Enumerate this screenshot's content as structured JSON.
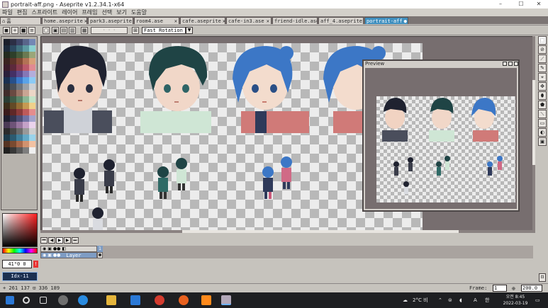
{
  "window": {
    "title": "portrait-aff.png - Aseprite v1.2.34.1-x64",
    "controls": {
      "minimize": "–",
      "maximize": "☐",
      "close": "✕"
    }
  },
  "menu": [
    "파일",
    "편집",
    "스프라이트",
    "레이어",
    "프레임",
    "선택",
    "보기",
    "도움말"
  ],
  "tabs": [
    {
      "label": "home.aseprite",
      "active": false
    },
    {
      "label": "park3.aseprite",
      "active": false
    },
    {
      "label": "room4.ase",
      "active": false
    },
    {
      "label": "cafe.aseprite",
      "active": false
    },
    {
      "label": "cafe-in3.ase",
      "active": false
    },
    {
      "label": "friend-idle.ase",
      "active": false
    },
    {
      "label": "aff_4.aseprite",
      "active": false
    },
    {
      "label": "portrait-aff",
      "active": true
    }
  ],
  "home_tab": "홈",
  "context_bar": {
    "rotation_algorithm": "Fast Rotation",
    "slider_placeholder": "· · ·"
  },
  "palette": {
    "colors": [
      "#1b1f2a",
      "#2c2f45",
      "#3e4466",
      "#59658a",
      "#7387b4",
      "#1d2a3a",
      "#2d4960",
      "#41707e",
      "#5d9aa2",
      "#8ad0cf",
      "#232a1e",
      "#2e3f2a",
      "#455a3b",
      "#6a7a52",
      "#9aa679",
      "#3a2320",
      "#5b3329",
      "#834a35",
      "#b37255",
      "#d9a079",
      "#3b1d2b",
      "#5d2a3c",
      "#8a3d50",
      "#bb5a6b",
      "#e08a92",
      "#2a1f3a",
      "#443065",
      "#5d4a8c",
      "#8577b6",
      "#b3addb",
      "#1a3050",
      "#27508a",
      "#3b7acb",
      "#5aa3e8",
      "#8ccbf5",
      "#2e3339",
      "#4a5058",
      "#6f767e",
      "#9aa1a8",
      "#ccd1d6",
      "#402c2a",
      "#6a4a42",
      "#9a7466",
      "#c9a593",
      "#ecd6c6",
      "#2a3d33",
      "#3f5c48",
      "#5b8367",
      "#8bb694",
      "#c2e3c7",
      "#3b2d1a",
      "#634a26",
      "#936d35",
      "#c69a52",
      "#f0d08a",
      "#3a1b1b",
      "#5f2828",
      "#8c3b3b",
      "#bf5a5a",
      "#e48d8d",
      "#1f1f2e",
      "#34344f",
      "#4e4e75",
      "#7373a3",
      "#a3a3cc",
      "#4b3a55",
      "#6e5378",
      "#98769f",
      "#c4a2c8",
      "#ead3ec",
      "#2b2b2b",
      "#474747",
      "#6b6b6b",
      "#999999",
      "#cfcfcf",
      "#1e3b4a",
      "#2c5a70",
      "#41809c",
      "#64a9c6",
      "#9ad3ea",
      "#553322",
      "#7a4a30",
      "#a8684a",
      "#d1926f",
      "#f2c1a2",
      "#202020",
      "#383838",
      "#585858",
      "#7d7d7d",
      "#efefef"
    ],
    "current_color_value": "41⁰0 0",
    "index_label": "Idx-11",
    "warn_symbol": "!"
  },
  "timeline": {
    "layer_name": "Layer",
    "frame_number": "1"
  },
  "status": {
    "position": "+ 261 137 ⊡ 336 189",
    "frame_label": "Frame:",
    "frame_value": "1",
    "zoom_value": "200.0"
  },
  "preview": {
    "title": "Preview"
  },
  "tools": [
    "⬚",
    "⊘",
    "⟋",
    "✎",
    "⌖",
    "✥",
    "⬮",
    "⬟",
    "⟍",
    "▭",
    "◐",
    "▣"
  ],
  "taskbar": {
    "weather": "2°C 비",
    "ime": "A",
    "lang": "한",
    "time": "오전 8:45",
    "date": "2022-03-19"
  }
}
